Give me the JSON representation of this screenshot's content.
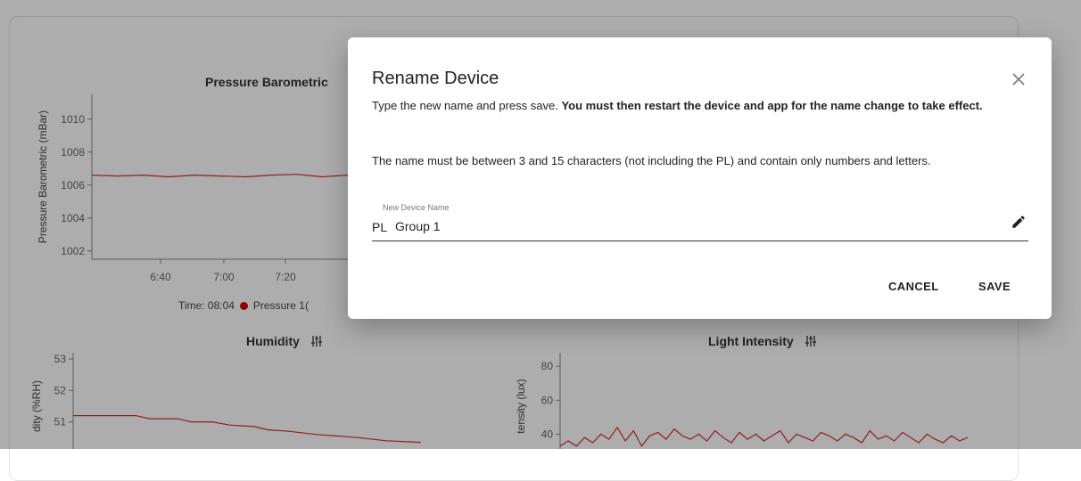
{
  "pressure_chart": {
    "title": "Pressure Barometric",
    "ylabel": "Pressure Barometric (mBar)",
    "legend_time": "Time: 08:04",
    "legend_series": "Pressure 1(",
    "chart_data": {
      "type": "line",
      "title": "Pressure Barometric",
      "ylabel": "Pressure Barometric (mBar)",
      "x_ticks": [
        "6:40",
        "7:00",
        "7:20"
      ],
      "y_ticks": [
        "1010",
        "1008",
        "1006",
        "1004",
        "1002"
      ],
      "ylim": [
        1001.5,
        1011.5
      ],
      "xlim": [
        0,
        100
      ],
      "series": [
        {
          "color": "#d32f2f",
          "x": [
            0,
            10,
            20,
            30,
            40,
            50,
            60,
            70,
            80,
            90,
            100
          ],
          "values": [
            1006.6,
            1006.55,
            1006.6,
            1006.5,
            1006.6,
            1006.55,
            1006.5,
            1006.6,
            1006.65,
            1006.5,
            1006.6
          ]
        }
      ]
    }
  },
  "humidity_chart": {
    "title": "Humidity",
    "ylabel": "dity (%RH)",
    "chart_data": {
      "type": "line",
      "title": "Humidity",
      "ylabel": "dity (%RH)",
      "y_ticks": [
        "53",
        "52",
        "51"
      ],
      "ylim": [
        49.8,
        53.2
      ],
      "xlim": [
        0,
        100
      ],
      "series": [
        {
          "color": "#d32f2f",
          "x": [
            0,
            18,
            22,
            30,
            34,
            40,
            45,
            52,
            56,
            62,
            70,
            76,
            82,
            90,
            100
          ],
          "values": [
            51.2,
            51.2,
            51.1,
            51.1,
            51.0,
            51.0,
            50.9,
            50.85,
            50.75,
            50.7,
            50.6,
            50.55,
            50.5,
            50.4,
            50.35
          ]
        }
      ]
    }
  },
  "light_chart": {
    "title": "Light Intensity",
    "ylabel": "tensity (lux)",
    "chart_data": {
      "type": "line",
      "title": "Light Intensity",
      "ylabel": "tensity (lux)",
      "y_ticks": [
        "80",
        "60",
        "40"
      ],
      "ylim": [
        25,
        88
      ],
      "xlim": [
        0,
        100
      ],
      "series": [
        {
          "color": "#d32f2f",
          "x": [
            0,
            2,
            4,
            6,
            8,
            10,
            12,
            14,
            16,
            18,
            20,
            22,
            24,
            26,
            28,
            30,
            32,
            34,
            36,
            38,
            40,
            42,
            44,
            46,
            48,
            50,
            52,
            54,
            56,
            58,
            60,
            62,
            64,
            66,
            68,
            70,
            72,
            74,
            76,
            78,
            80,
            82,
            84,
            86,
            88,
            90,
            92,
            94,
            96,
            98,
            100
          ],
          "values": [
            33,
            36,
            33,
            38,
            35,
            40,
            37,
            44,
            36,
            42,
            33,
            39,
            41,
            37,
            43,
            39,
            37,
            40,
            36,
            42,
            38,
            35,
            41,
            37,
            40,
            36,
            39,
            42,
            35,
            40,
            38,
            36,
            41,
            39,
            36,
            40,
            38,
            35,
            42,
            37,
            39,
            36,
            41,
            38,
            35,
            40,
            37,
            35,
            39,
            36,
            38
          ]
        }
      ]
    }
  },
  "dialog": {
    "title": "Rename Device",
    "instruction_plain": "Type the new name and press save. ",
    "instruction_bold": "You must then restart the device and app for the name change to take effect.",
    "rules": "The name must be between 3 and 15 characters (not including the PL) and contain only numbers and letters.",
    "field_label": "New Device Name",
    "field_prefix": "PL",
    "field_value": "Group 1",
    "cancel_label": "CANCEL",
    "save_label": "SAVE"
  },
  "colors": {
    "series": "#d32f2f",
    "legend_dot": "#d40000",
    "overlay": "rgba(0,0,0,0.32)"
  },
  "icons": [
    "sliders-icon",
    "close-icon",
    "pencil-icon"
  ]
}
